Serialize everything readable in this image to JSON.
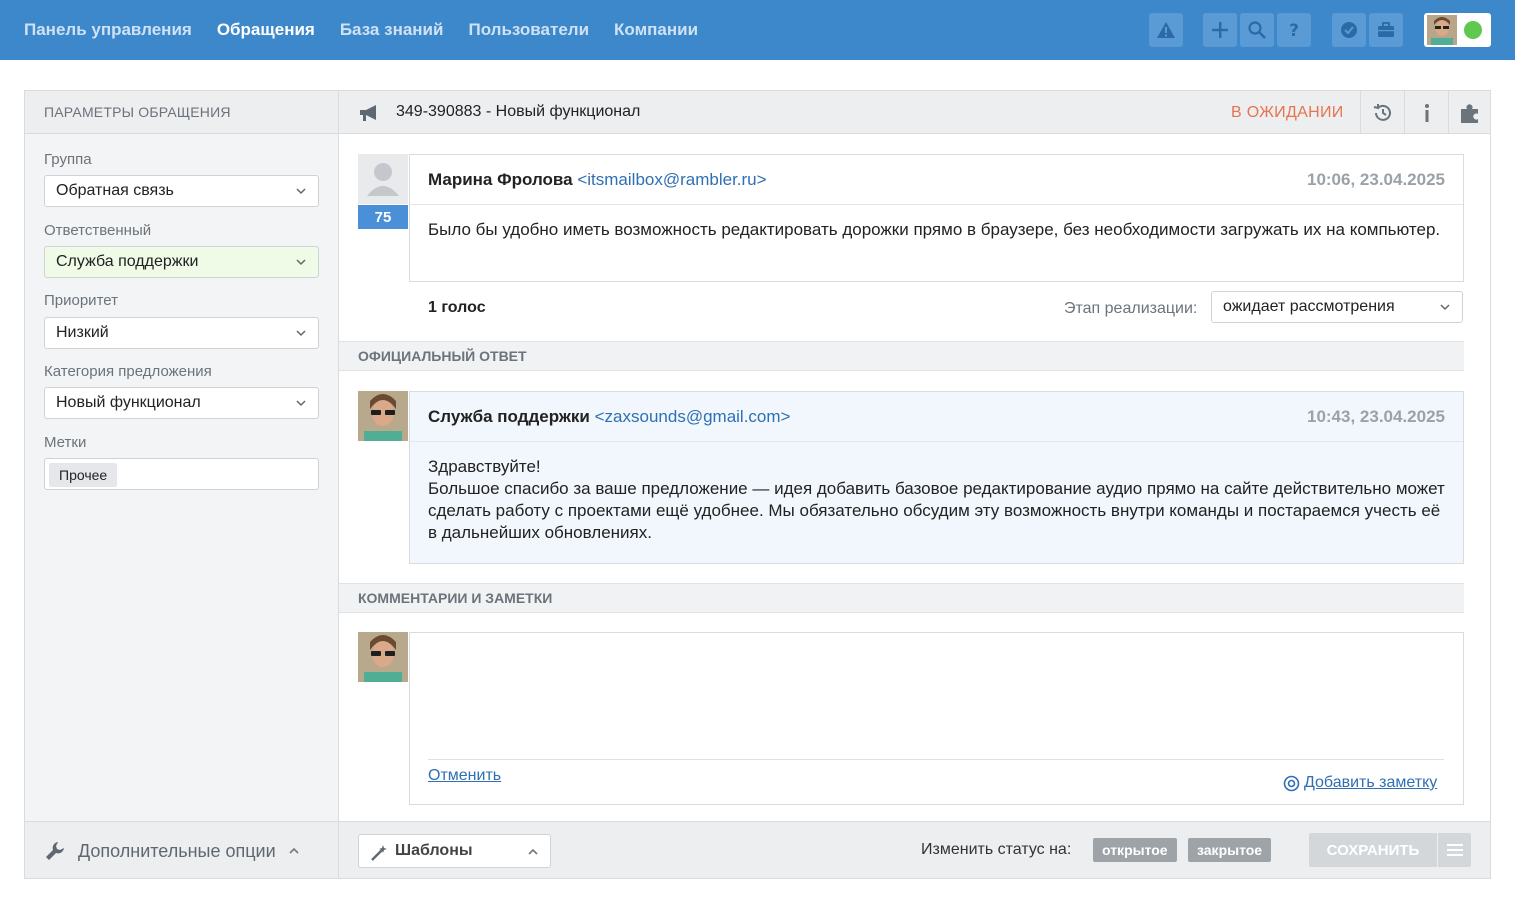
{
  "nav": {
    "items": [
      {
        "label": "Панель управления",
        "active": false
      },
      {
        "label": "Обращения",
        "active": true
      },
      {
        "label": "База знаний",
        "active": false
      },
      {
        "label": "Пользователи",
        "active": false
      },
      {
        "label": "Компании",
        "active": false
      }
    ]
  },
  "sidebar": {
    "header": "ПАРАМЕТРЫ ОБРАЩЕНИЯ",
    "group_label": "Группа",
    "group_value": "Обратная связь",
    "assignee_label": "Ответственный",
    "assignee_value": "Служба поддержки",
    "priority_label": "Приоритет",
    "priority_value": "Низкий",
    "category_label": "Категория предложения",
    "category_value": "Новый функционал",
    "tags_label": "Метки",
    "tags": [
      "Прочее"
    ],
    "more_options": "Дополнительные опции"
  },
  "ticket": {
    "title": "349-390883 - Новый функционал",
    "status": "В ОЖИДАНИИ"
  },
  "message": {
    "author_name": "Марина Фролова",
    "author_email": "<itsmailbox@rambler.ru>",
    "time": "10:06, 23.04.2025",
    "rating": "75",
    "body": "Было бы удобно иметь возможность редактировать дорожки прямо в браузере, без необходимости загружать их на компьютер.",
    "votes": "1 голос",
    "stage_label": "Этап реализации:",
    "stage_value": "ожидает рассмотрения"
  },
  "official": {
    "header": "ОФИЦИАЛЬНЫЙ ОТВЕТ",
    "author_name": "Служба поддержки",
    "author_email": "<zaxsounds@gmail.com>",
    "time": "10:43, 23.04.2025",
    "line1": "Здравствуйте!",
    "line2": "Большое спасибо за ваше предложение — идея добавить базовое редактирование аудио прямо на сайте действительно может сделать работу с проектами ещё удобнее. Мы обязательно обсудим эту возможность внутри команды и постараемся учесть её в дальнейших обновлениях."
  },
  "comments": {
    "header": "КОММЕНТАРИИ И ЗАМЕТКИ",
    "cancel": "Отменить",
    "add_note": "Добавить заметку"
  },
  "footer": {
    "templates": "Шаблоны",
    "change_status": "Изменить статус на:",
    "status_open": "открытое",
    "status_closed": "закрытое",
    "save": "СОХРАНИТЬ"
  },
  "colors": {
    "topbar": "#3d87cb",
    "status": "#e8744f",
    "link": "#2f6fb3",
    "online": "#5fc84f"
  }
}
